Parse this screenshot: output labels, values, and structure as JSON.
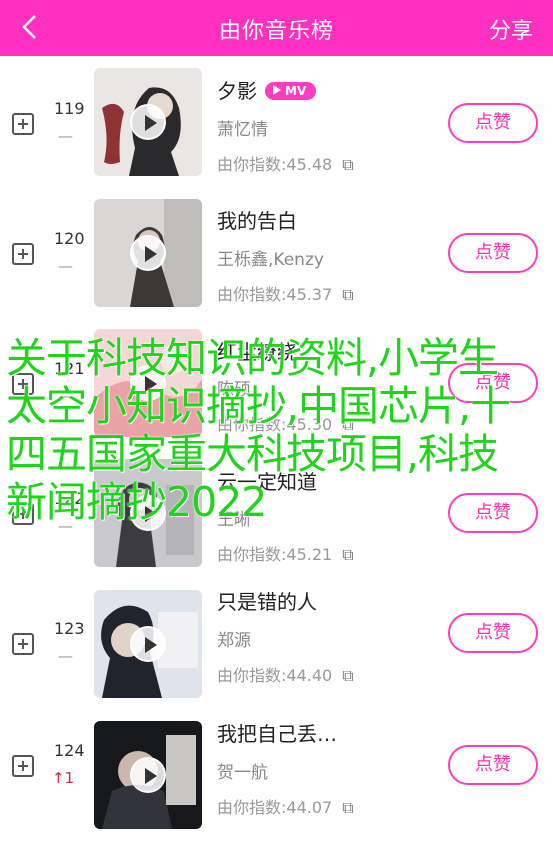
{
  "header": {
    "title": "由你音乐榜",
    "share": "分享",
    "back_icon": "chevron-left-icon"
  },
  "colors": {
    "brand": "#ff2fc0",
    "accent_pink": "#ff3cc2",
    "trend_up": "#e0223b",
    "overlay_green": "#1fd51a"
  },
  "songs": [
    {
      "rank": "119",
      "trend": "—",
      "title": "夕影",
      "mv": "MV",
      "artist": "萧忆情",
      "index": "由你指数:45.48",
      "like": "点赞"
    },
    {
      "rank": "120",
      "trend": "—",
      "title": "我的告白",
      "artist": "王栎鑫,Kenzy",
      "index": "由你指数:45.37",
      "like": "点赞"
    },
    {
      "rank": "121",
      "trend": "—",
      "title": "红尘缭绕",
      "artist": "陈硕",
      "index": "由你指数:45.30",
      "like": "点赞"
    },
    {
      "rank": "122",
      "trend": "—",
      "title": "云一定知道",
      "artist": "王晰",
      "index": "由你指数:45.21",
      "like": "点赞"
    },
    {
      "rank": "123",
      "trend": "—",
      "title": "只是错的人",
      "artist": "郑源",
      "index": "由你指数:44.40",
      "like": "点赞"
    },
    {
      "rank": "124",
      "trend": "↑1",
      "title": "我把自己丢…",
      "artist": "贺一航",
      "index": "由你指数:44.07",
      "like": "点赞"
    }
  ],
  "overlay_text": "关于科技知识的资料,小学生太空小知识摘抄,中国芯片,十四五国家重大科技项目,科技新闻摘抄2022"
}
